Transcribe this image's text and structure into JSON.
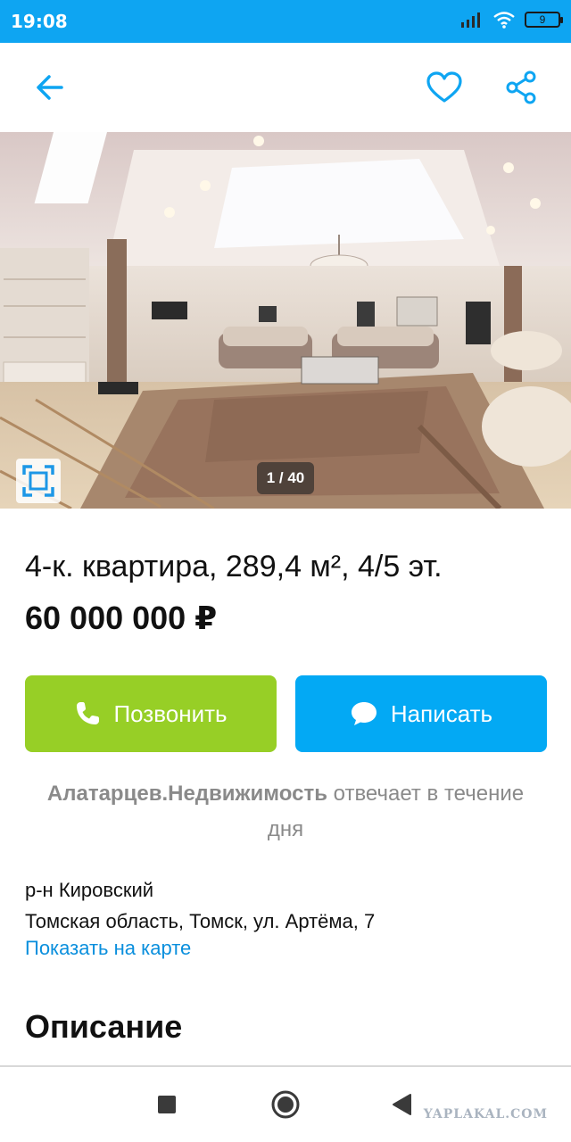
{
  "status_bar": {
    "time": "19:08",
    "battery": "9"
  },
  "toolbar": {
    "back_icon": "arrow-left-icon",
    "favorite_icon": "heart-icon",
    "share_icon": "share-icon",
    "accent_color": "#0ea5f2"
  },
  "gallery": {
    "counter": "1 / 40",
    "fullscreen_icon": "fullscreen-icon"
  },
  "listing": {
    "title": "4-к. квартира, 289,4 м², 4/5 эт.",
    "price": "60 000 000 ₽"
  },
  "actions": {
    "call_label": "Позвонить",
    "call_icon": "phone-icon",
    "call_color": "#97cf26",
    "write_label": "Написать",
    "write_icon": "chat-bubble-icon",
    "write_color": "#03a9f4"
  },
  "seller": {
    "name": "Алатарцев.Недвижимость",
    "response_text": "отвечает в течение дня"
  },
  "location": {
    "district": "р-н Кировский",
    "address": "Томская область, Томск, ул. Артёма, 7",
    "map_link": "Показать на карте"
  },
  "description": {
    "heading": "Описание"
  },
  "nav": {
    "watermark": "YAPLAKAL.COM"
  }
}
